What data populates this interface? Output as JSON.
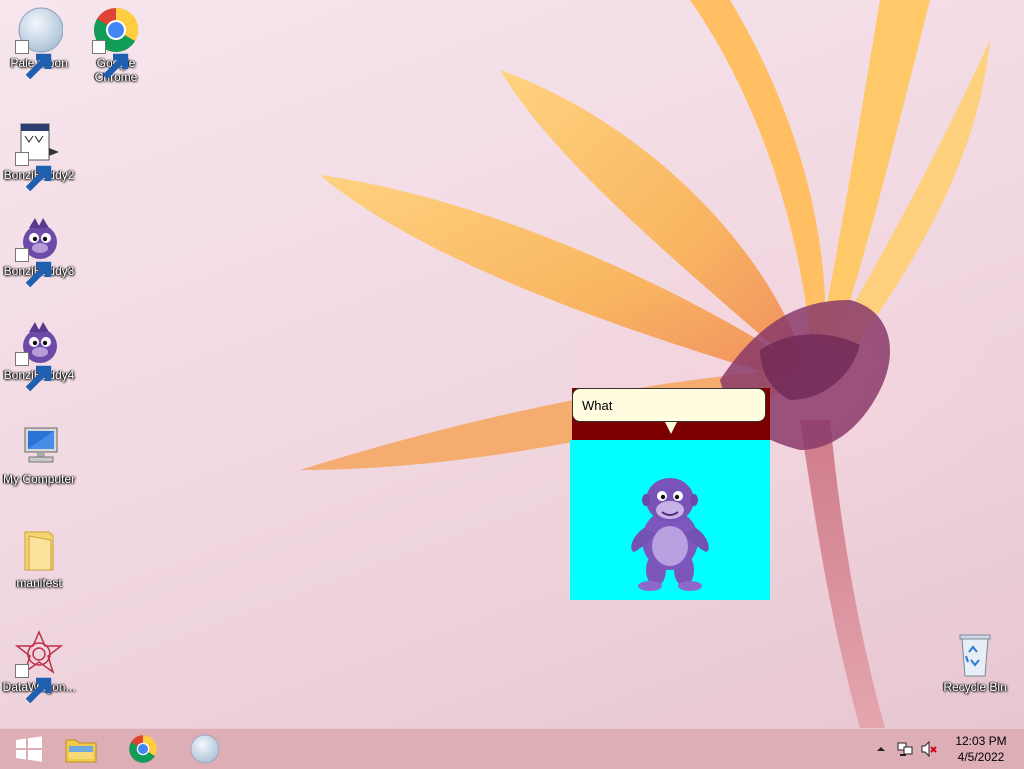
{
  "desktop": {
    "icons": [
      {
        "label": "Pale Moon",
        "icon": "pale-moon-icon"
      },
      {
        "label": "Google Chrome",
        "icon": "chrome-icon"
      },
      {
        "label": "BonziBuddy2",
        "icon": "bonzibuddy2-icon"
      },
      {
        "label": "BonziBuddy3",
        "icon": "bonzibuddy3-icon"
      },
      {
        "label": "BonziBuddy4",
        "icon": "bonzibuddy4-icon"
      },
      {
        "label": "My Computer",
        "icon": "computer-icon"
      },
      {
        "label": "manifest",
        "icon": "folder-icon"
      },
      {
        "label": "DataWagon...",
        "icon": "datawagon-icon"
      },
      {
        "label": "Recycle Bin",
        "icon": "recycle-bin-icon"
      }
    ]
  },
  "agent": {
    "speech": "What",
    "background_color": "#00ffff",
    "bubble_border_color": "#7d0000"
  },
  "taskbar": {
    "start_icon": "windows-start-icon",
    "pinned": [
      {
        "icon": "file-explorer-icon"
      },
      {
        "icon": "chrome-icon"
      },
      {
        "icon": "pale-moon-icon"
      }
    ],
    "tray": {
      "icons": [
        "show-hidden-icons-chevron",
        "network-icon",
        "volume-muted-icon"
      ]
    },
    "clock": {
      "time": "12:03 PM",
      "date": "4/5/2022"
    }
  }
}
